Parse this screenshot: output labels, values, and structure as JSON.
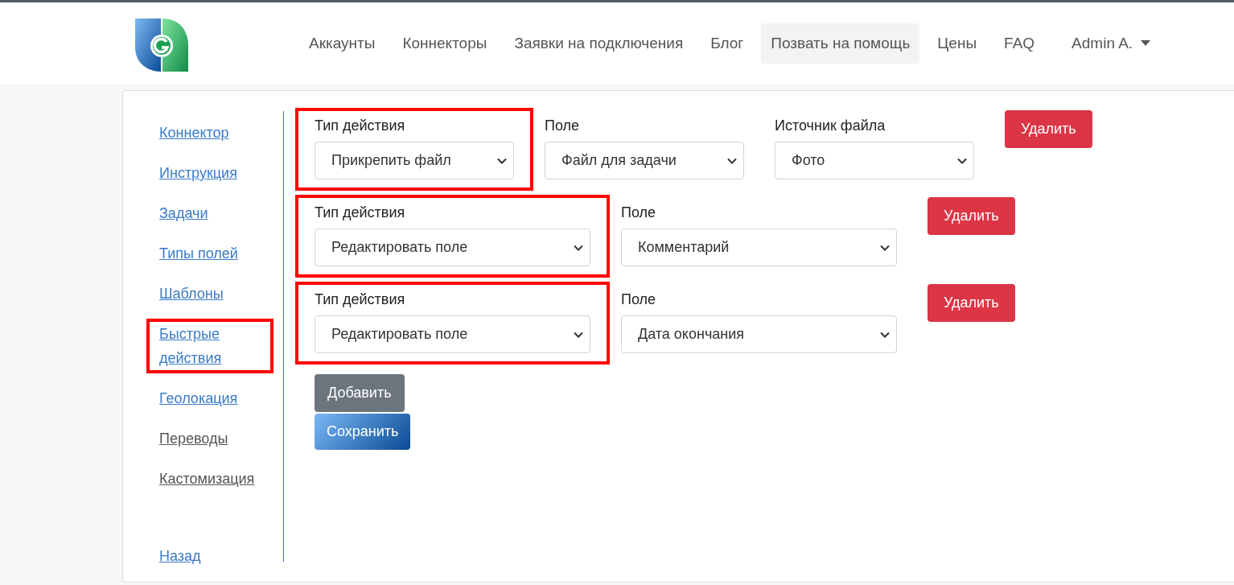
{
  "header": {
    "nav": [
      {
        "label": "Аккаунты",
        "selected": false
      },
      {
        "label": "Коннекторы",
        "selected": false
      },
      {
        "label": "Заявки на подключения",
        "selected": false
      },
      {
        "label": "Блог",
        "selected": false
      },
      {
        "label": "Позвать на помощь",
        "selected": true
      },
      {
        "label": "Цены",
        "selected": false
      },
      {
        "label": "FAQ",
        "selected": false
      }
    ],
    "user": "Admin A."
  },
  "sidebar": {
    "items": [
      {
        "label": "Коннектор",
        "color": "#3a7bc8",
        "highlighted": false
      },
      {
        "label": "Инструкция",
        "color": "#3a7bc8",
        "highlighted": false
      },
      {
        "label": "Задачи",
        "color": "#3a7bc8",
        "highlighted": false
      },
      {
        "label": "Типы полей",
        "color": "#3a7bc8",
        "highlighted": false
      },
      {
        "label": "Шаблоны",
        "color": "#3a7bc8",
        "highlighted": false
      },
      {
        "label": "Быстрые действия",
        "color": "#3a7bc8",
        "highlighted": true
      },
      {
        "label": "Геолокация",
        "color": "#3a7bc8",
        "highlighted": false
      },
      {
        "label": "Переводы",
        "color": "#555555",
        "highlighted": false
      },
      {
        "label": "Кастомизация",
        "color": "#555555",
        "highlighted": false
      }
    ],
    "back": {
      "label": "Назад",
      "color": "#3a7bc8"
    }
  },
  "actions": [
    {
      "highlighted": true,
      "fields": [
        {
          "label": "Тип действия",
          "value": "Прикрепить файл"
        },
        {
          "label": "Поле",
          "value": "Файл для задачи"
        },
        {
          "label": "Источник файла",
          "value": "Фото"
        }
      ],
      "delete_button": "Удалить"
    },
    {
      "highlighted": true,
      "fields": [
        {
          "label": "Тип действия",
          "value": "Редактировать поле"
        },
        {
          "label": "Поле",
          "value": "Комментарий"
        }
      ],
      "delete_button": "Удалить"
    },
    {
      "highlighted": true,
      "fields": [
        {
          "label": "Тип действия",
          "value": "Редактировать поле"
        },
        {
          "label": "Поле",
          "value": "Дата окончания"
        }
      ],
      "delete_button": "Удалить"
    }
  ],
  "add_button": "Добавить",
  "save_button": "Сохранить"
}
